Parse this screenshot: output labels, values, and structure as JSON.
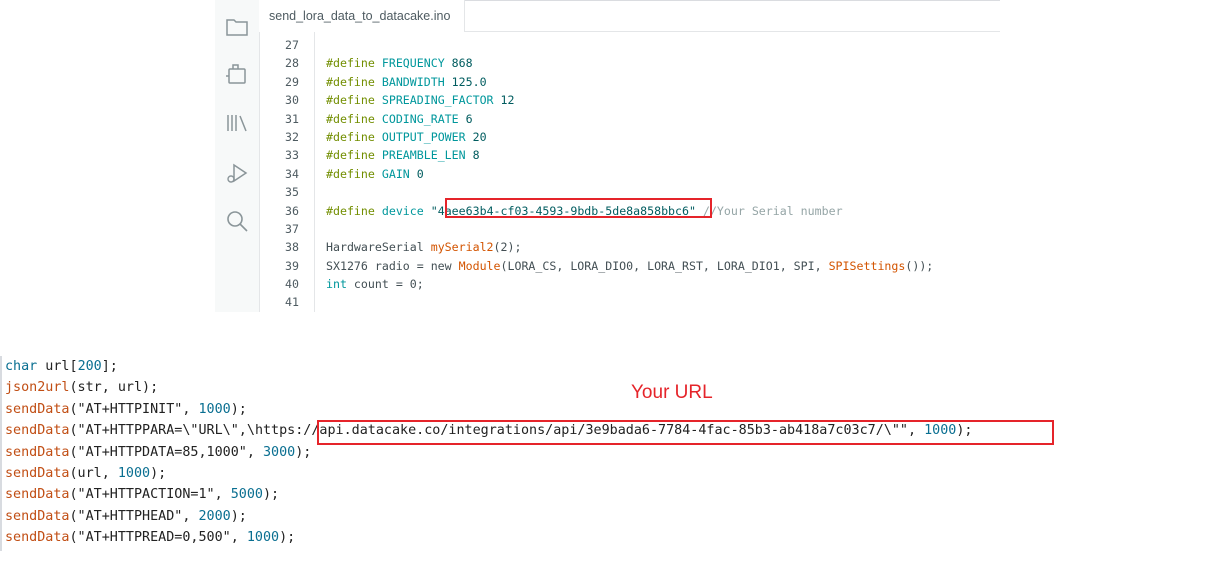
{
  "ide": {
    "tab_title": "send_lora_data_to_datacake.ino",
    "sidebar_icons": [
      "folder-icon",
      "board-icon",
      "library-icon",
      "debug-icon",
      "search-icon"
    ],
    "lines": [
      {
        "num": "27",
        "text": ""
      },
      {
        "num": "28",
        "kw": "#define",
        "name": "FREQUENCY",
        "val": "868"
      },
      {
        "num": "29",
        "kw": "#define",
        "name": "BANDWIDTH",
        "val": "125.0"
      },
      {
        "num": "30",
        "kw": "#define",
        "name": "SPREADING_FACTOR",
        "val": "12"
      },
      {
        "num": "31",
        "kw": "#define",
        "name": "CODING_RATE",
        "val": "6"
      },
      {
        "num": "32",
        "kw": "#define",
        "name": "OUTPUT_POWER",
        "val": "20"
      },
      {
        "num": "33",
        "kw": "#define",
        "name": "PREAMBLE_LEN",
        "val": "8"
      },
      {
        "num": "34",
        "kw": "#define",
        "name": "GAIN",
        "val": "0"
      },
      {
        "num": "35",
        "text": ""
      },
      {
        "num": "36",
        "kw": "#define",
        "name": "device",
        "q1": "\"",
        "serial": "4aee63b4-cf03-4593-9bdb-5de8a858bbc6",
        "q2": "\"",
        "comment": " //Your Serial number"
      },
      {
        "num": "37",
        "text": ""
      },
      {
        "num": "38",
        "type": "HardwareSerial",
        "mid": " ",
        "obj": "mySerial2",
        "rest": "(2);"
      },
      {
        "num": "39",
        "a": "SX1276 radio = new ",
        "fn": "Module",
        "b": "(LORA_CS, LORA_DIO0, LORA_RST, LORA_DIO1, SPI, ",
        "fn2": "SPISettings",
        "c": "());"
      },
      {
        "num": "40",
        "type": "int",
        "rest": " count = 0;"
      },
      {
        "num": "41",
        "text": ""
      }
    ]
  },
  "snippet": {
    "annotation": "Your URL",
    "l1": {
      "type": "char",
      "rest1": " url[",
      "n": "200",
      "rest2": "];"
    },
    "l2": {
      "fn": "json2url",
      "rest": "(str, url);"
    },
    "l3": {
      "fn": "sendData",
      "s": "(\"AT+HTTPINIT\", ",
      "n": "1000",
      "e": ");"
    },
    "l4": {
      "fn": "sendData",
      "s1": "(\"AT+HTTPPARA=\\\"URL\\\",\\",
      "url": "https://api.datacake.co/integrations/api/3e9bada6-7784-4fac-85b3-ab418a7c03c7/",
      "s2": "\\\"\", ",
      "n": "1000",
      "e": ");"
    },
    "l5": {
      "fn": "sendData",
      "s": "(\"AT+HTTPDATA=85,1000\", ",
      "n": "3000",
      "e": ");"
    },
    "l6": {
      "fn": "sendData",
      "s": "(url, ",
      "n": "1000",
      "e": ");"
    },
    "l7": {
      "fn": "sendData",
      "s": "(\"AT+HTTPACTION=1\", ",
      "n": "5000",
      "e": ");"
    },
    "l8": {
      "fn": "sendData",
      "s": "(\"AT+HTTPHEAD\", ",
      "n": "2000",
      "e": ");"
    },
    "l9": {
      "fn": "sendData",
      "s": "(\"AT+HTTPREAD=0,500\", ",
      "n": "1000",
      "e": ");"
    }
  },
  "colors": {
    "highlight": "#e5242a",
    "accent": "#00979c"
  }
}
